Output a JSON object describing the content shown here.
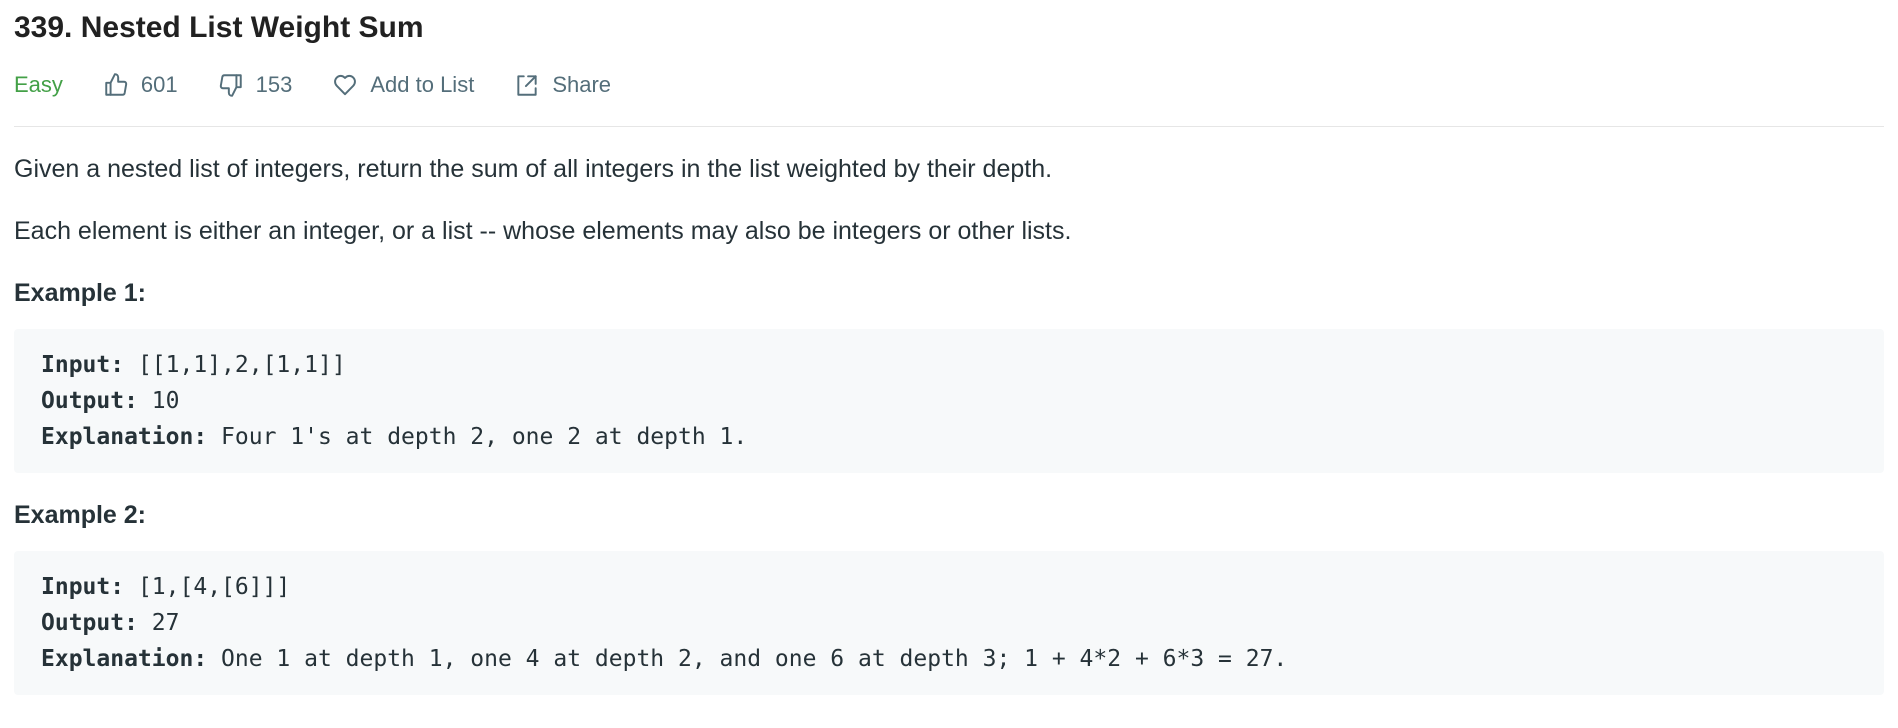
{
  "problem": {
    "title": "339. Nested List Weight Sum",
    "difficulty": "Easy",
    "likes": "601",
    "dislikes": "153",
    "add_to_list_label": "Add to List",
    "share_label": "Share"
  },
  "description": {
    "paragraphs": [
      "Given a nested list of integers, return the sum of all integers in the list weighted by their depth.",
      "Each element is either an integer, or a list -- whose elements may also be integers or other lists."
    ]
  },
  "examples": [
    {
      "title": "Example 1:",
      "input_label": "Input:",
      "input": "[[1,1],2,[1,1]]",
      "output_label": "Output:",
      "output": "10",
      "explanation_label": "Explanation:",
      "explanation": "Four 1's at depth 2, one 2 at depth 1."
    },
    {
      "title": "Example 2:",
      "input_label": "Input:",
      "input": "[1,[4,[6]]]",
      "output_label": "Output:",
      "output": "27",
      "explanation_label": "Explanation:",
      "explanation": "One 1 at depth 1, one 4 at depth 2, and one 6 at depth 3; 1 + 4*2 + 6*3 = 27."
    }
  ],
  "icons": {
    "like": "thumbs-up-icon",
    "dislike": "thumbs-down-icon",
    "add_to_list": "heart-icon",
    "share": "share-icon"
  },
  "colors": {
    "difficulty_easy": "#43a047",
    "text": "#263238",
    "meta_text": "#546e7a",
    "code_background": "#f7f9fa",
    "divider": "#e6e6e6"
  }
}
